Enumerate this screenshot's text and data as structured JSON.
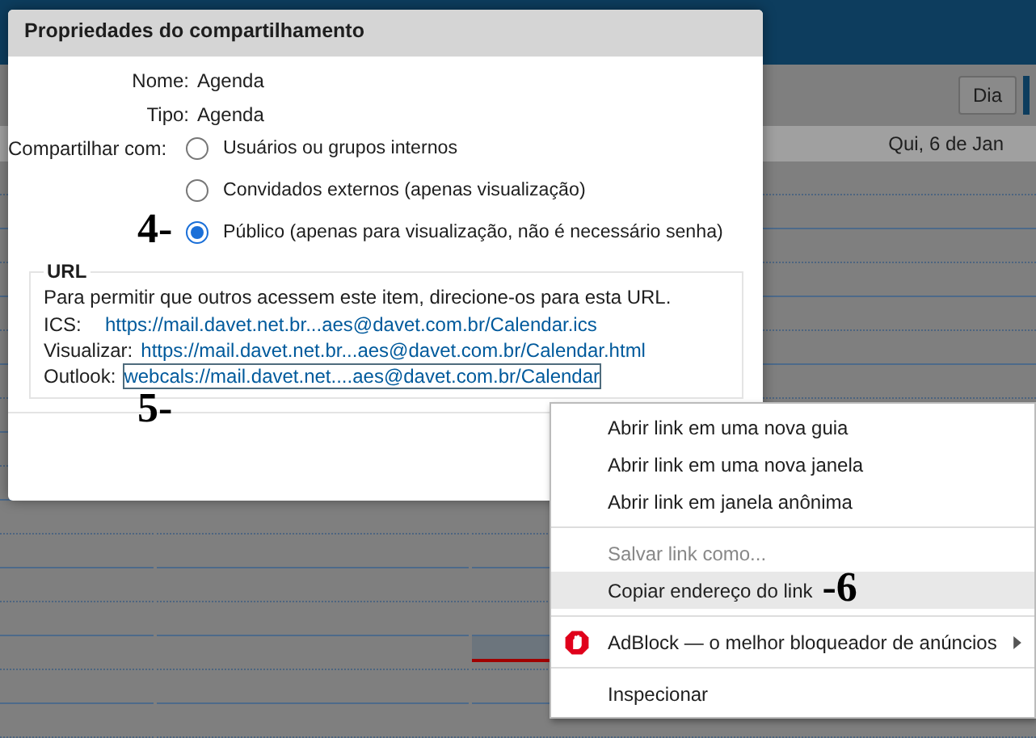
{
  "calendar": {
    "view_button": "Dia",
    "day_header": "Qui, 6 de Jan"
  },
  "dialog": {
    "title": "Propriedades do compartilhamento",
    "fields": [
      {
        "label": "Nome:",
        "value": "Agenda"
      },
      {
        "label": "Tipo:",
        "value": "Agenda"
      }
    ],
    "share_label": "Compartilhar com:",
    "share_options": [
      {
        "label": "Usuários ou grupos internos",
        "selected": false
      },
      {
        "label": "Convidados externos (apenas visualização)",
        "selected": false
      },
      {
        "label": "Público (apenas para visualização, não é necessário senha)",
        "selected": true,
        "annotation": "4-"
      }
    ],
    "url_section": {
      "legend": "URL",
      "description": "Para permitir que outros acessem este item, direcione-os para esta URL.",
      "links": [
        {
          "label": "ICS:",
          "url": "https://mail.davet.net.br...aes@davet.com.br/Calendar.ics",
          "focused": false
        },
        {
          "label": "Visualizar:",
          "url": "https://mail.davet.net.br...aes@davet.com.br/Calendar.html",
          "focused": false
        },
        {
          "label": "Outlook:",
          "url": "webcals://mail.davet.net....aes@davet.com.br/Calendar",
          "focused": true,
          "annotation": "5-"
        }
      ]
    }
  },
  "context_menu": [
    {
      "kind": "item",
      "label": "Abrir link em uma nova guia",
      "disabled": false,
      "selected": false
    },
    {
      "kind": "item",
      "label": "Abrir link em uma nova janela",
      "disabled": false,
      "selected": false
    },
    {
      "kind": "item",
      "label": "Abrir link em janela anônima",
      "disabled": false,
      "selected": false
    },
    {
      "kind": "separator"
    },
    {
      "kind": "item",
      "label": "Salvar link como...",
      "disabled": true,
      "selected": false
    },
    {
      "kind": "item",
      "label": "Copiar endereço do link",
      "disabled": false,
      "selected": true,
      "annotation": "-6"
    },
    {
      "kind": "separator"
    },
    {
      "kind": "extension",
      "label": "AdBlock — o melhor bloqueador de anúncios",
      "disabled": false,
      "selected": false
    },
    {
      "kind": "separator"
    },
    {
      "kind": "item",
      "label": "Inspecionar",
      "disabled": false,
      "selected": false
    }
  ]
}
